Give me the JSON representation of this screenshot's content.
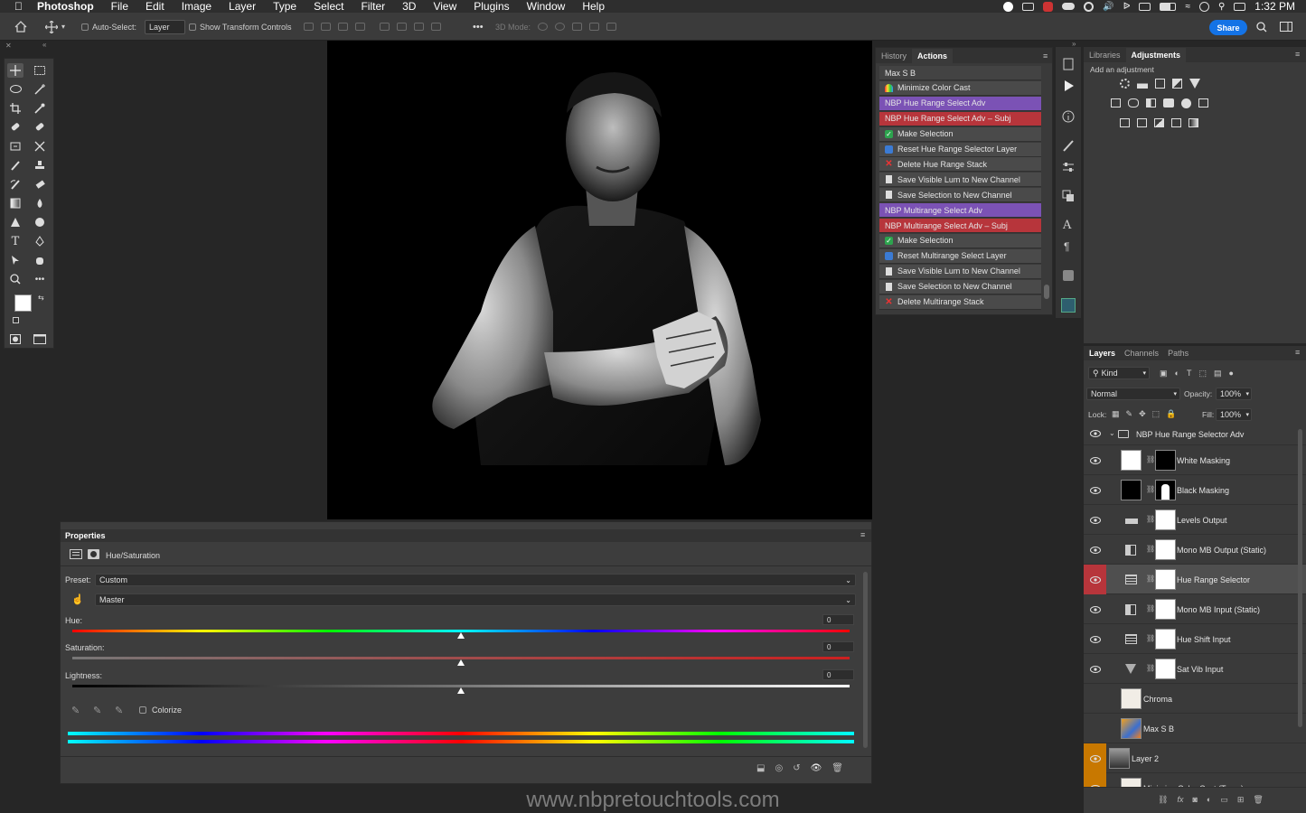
{
  "menubar": {
    "app_name": "Photoshop",
    "items": [
      "File",
      "Edit",
      "Image",
      "Layer",
      "Type",
      "Select",
      "Filter",
      "3D",
      "View",
      "Plugins",
      "Window",
      "Help"
    ],
    "clock": "1:32 PM"
  },
  "options_bar": {
    "auto_select_label": "Auto-Select:",
    "auto_select_value": "Layer",
    "show_transform_label": "Show Transform Controls",
    "mode_3d_label": "3D Mode:",
    "more_label": "•••",
    "share_label": "Share"
  },
  "actions_panel": {
    "tabs": [
      "History",
      "Actions"
    ],
    "active_tab": "Actions",
    "items": [
      {
        "label": "Max S B",
        "style": "top",
        "marker": ""
      },
      {
        "label": "Minimize Color Cast",
        "style": "plain",
        "marker": "rainbow"
      },
      {
        "label": "NBP Hue Range Select Adv",
        "style": "purple",
        "marker": ""
      },
      {
        "label": "NBP Hue Range Select Adv – Subj",
        "style": "red",
        "marker": ""
      },
      {
        "label": "Make Selection",
        "style": "plain",
        "marker": "check"
      },
      {
        "label": "Reset Hue Range Selector Layer",
        "style": "plain",
        "marker": "reset"
      },
      {
        "label": "Delete Hue Range Stack",
        "style": "plain",
        "marker": "x"
      },
      {
        "label": "Save Visible Lum to New Channel",
        "style": "plain",
        "marker": "doc"
      },
      {
        "label": "Save Selection to New Channel",
        "style": "plain",
        "marker": "doc"
      },
      {
        "label": "NBP Multirange Select Adv",
        "style": "purple",
        "marker": ""
      },
      {
        "label": "NBP Multirange Select Adv – Subj",
        "style": "red",
        "marker": ""
      },
      {
        "label": "Make Selection",
        "style": "plain",
        "marker": "check"
      },
      {
        "label": "Reset Multirange Select Layer",
        "style": "plain",
        "marker": "reset"
      },
      {
        "label": "Save Visible Lum to New Channel",
        "style": "plain",
        "marker": "doc"
      },
      {
        "label": "Save Selection to New Channel",
        "style": "plain",
        "marker": "doc"
      },
      {
        "label": "Delete Multirange Stack",
        "style": "plain",
        "marker": "x"
      }
    ]
  },
  "libraries_panel": {
    "tabs": [
      "Libraries",
      "Adjustments"
    ],
    "active_tab": "Adjustments",
    "hint": "Add an adjustment"
  },
  "layers_panel": {
    "tabs": [
      "Layers",
      "Channels",
      "Paths"
    ],
    "kind_label": "Kind",
    "blend_mode": "Normal",
    "opacity_label": "Opacity:",
    "opacity_value": "100%",
    "lock_label": "Lock:",
    "fill_label": "Fill:",
    "fill_value": "100%",
    "group_name": "NBP Hue Range Selector Adv",
    "layers": [
      {
        "name": "White Masking",
        "kind": "fill-white",
        "visible": true,
        "selected": false
      },
      {
        "name": "Black Masking",
        "kind": "fill-black",
        "visible": true,
        "selected": false
      },
      {
        "name": "Levels Output",
        "kind": "levels",
        "visible": true,
        "selected": false
      },
      {
        "name": "Mono MB Output (Static)",
        "kind": "bw",
        "visible": true,
        "selected": false
      },
      {
        "name": "Hue Range Selector",
        "kind": "huesat",
        "visible": true,
        "selected": true
      },
      {
        "name": "Mono MB Input (Static)",
        "kind": "bw",
        "visible": true,
        "selected": false
      },
      {
        "name": "Hue Shift Input",
        "kind": "huesat",
        "visible": true,
        "selected": false
      },
      {
        "name": "Sat Vib Input",
        "kind": "vibrance",
        "visible": true,
        "selected": false
      },
      {
        "name": "Chroma",
        "kind": "pixel-light",
        "visible": false,
        "selected": false
      },
      {
        "name": "Max S B",
        "kind": "pixel-orange",
        "visible": false,
        "selected": false
      },
      {
        "name": "Layer 2",
        "kind": "pixel-photo",
        "visible": true,
        "selected": false
      },
      {
        "name": "Minimize Color Cast (Temp)",
        "kind": "pixel-light",
        "visible": true,
        "selected": false
      }
    ]
  },
  "properties_panel": {
    "title": "Properties",
    "adjustment_name": "Hue/Saturation",
    "preset_label": "Preset:",
    "preset_value": "Custom",
    "channel_value": "Master",
    "hue_label": "Hue:",
    "hue_value": "0",
    "saturation_label": "Saturation:",
    "saturation_value": "0",
    "lightness_label": "Lightness:",
    "lightness_value": "0",
    "colorize_label": "Colorize",
    "colorize_checked": false
  },
  "watermark": "www.nbpretouchtools.com",
  "colors": {
    "accent_blue": "#1473e6",
    "action_purple": "#7b52b5",
    "action_red": "#b7353b",
    "eye_highlight_red": "#b7353b",
    "eye_highlight_orange": "#c87800"
  }
}
